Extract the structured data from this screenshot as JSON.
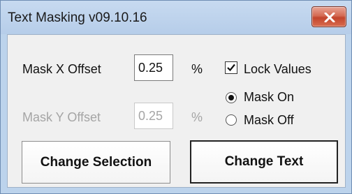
{
  "window": {
    "title": "Text Masking v09.10.16",
    "close_icon": "close-icon"
  },
  "mask_x": {
    "label": "Mask X Offset",
    "value": "0.25",
    "unit": "%",
    "enabled": true
  },
  "mask_y": {
    "label": "Mask Y Offset",
    "value": "0.25",
    "unit": "%",
    "enabled": false
  },
  "lock_values": {
    "label": "Lock Values",
    "checked": true
  },
  "mask_mode": {
    "options": [
      {
        "label": "Mask On",
        "selected": true
      },
      {
        "label": "Mask Off",
        "selected": false
      }
    ]
  },
  "buttons": {
    "change_selection": "Change Selection",
    "change_text": "Change Text"
  },
  "colors": {
    "title_bar": "#bcd3ec",
    "close_button": "#c2452d",
    "dialog_background": "#f0f0f0",
    "disabled_text": "#a5a5a5"
  }
}
